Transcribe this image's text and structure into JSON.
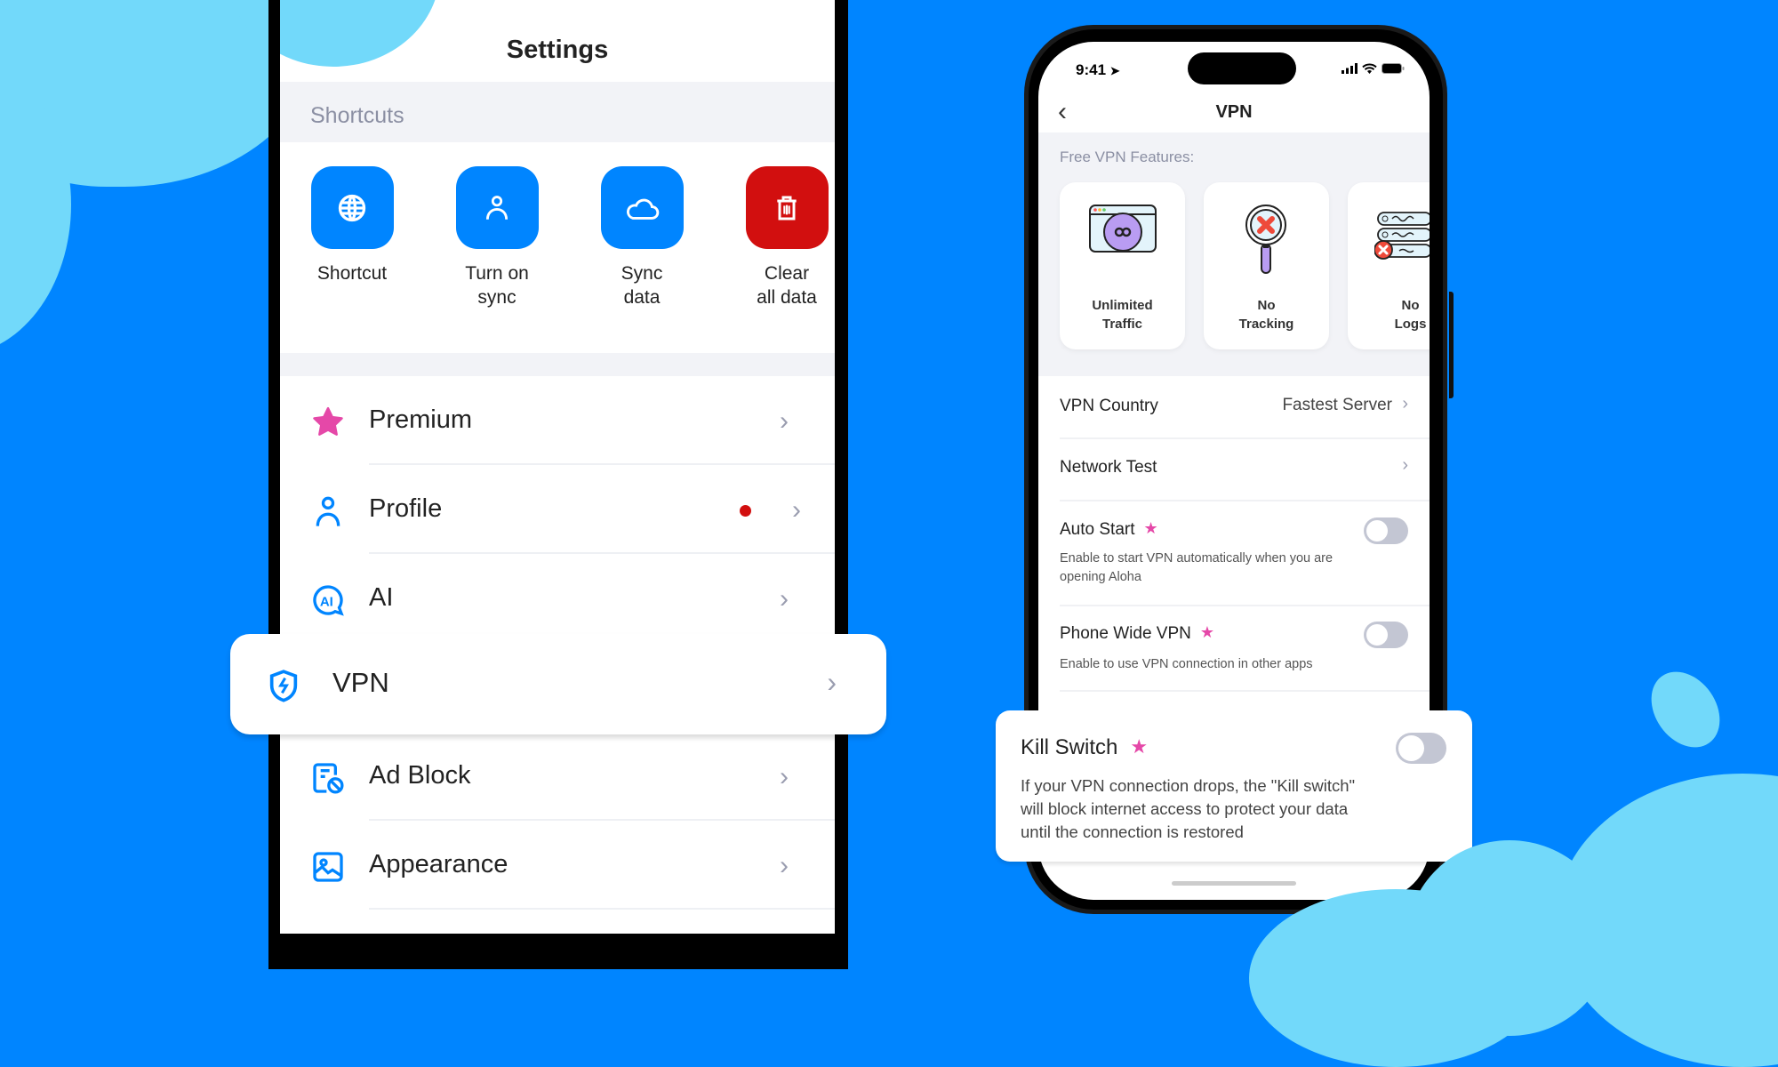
{
  "colors": {
    "background": "#0085FF",
    "blob": "#72D9FA",
    "accent_blue": "#0085FF",
    "danger_red": "#D20F0F",
    "premium_pink": "#E548A8",
    "toggle_off": "#C3C6D3"
  },
  "settings_screen": {
    "title": "Settings",
    "shortcuts_header": "Shortcuts",
    "shortcuts": [
      {
        "icon": "globe-icon",
        "label": "Shortcut"
      },
      {
        "icon": "person-icon",
        "label": "Turn on\nsync"
      },
      {
        "icon": "cloud-icon",
        "label": "Sync\ndata"
      },
      {
        "icon": "trash-icon",
        "label": "Clear\nall data"
      }
    ],
    "items": [
      {
        "icon": "star-icon",
        "label": "Premium",
        "chevron": "›"
      },
      {
        "icon": "person-icon",
        "label": "Profile",
        "chevron": "›",
        "badge": "red-dot"
      },
      {
        "icon": "ai-chat-icon",
        "label": "AI",
        "chevron": "›"
      },
      {
        "icon": "shield-bolt-icon",
        "label": "VPN",
        "chevron": "›",
        "highlighted": true
      },
      {
        "icon": "ad-block-icon",
        "label": "Ad Block",
        "chevron": "›"
      },
      {
        "icon": "image-icon",
        "label": "Appearance",
        "chevron": "›"
      }
    ]
  },
  "vpn_screen": {
    "status_bar": {
      "time": "9:41"
    },
    "nav": {
      "back": "‹",
      "title": "VPN"
    },
    "features_header": "Free VPN Features:",
    "features": [
      {
        "icon": "unlimited-traffic-icon",
        "line1": "Unlimited",
        "line2": "Traffic"
      },
      {
        "icon": "no-tracking-icon",
        "line1": "No",
        "line2": "Tracking"
      },
      {
        "icon": "no-logs-icon",
        "line1": "No",
        "line2": "Logs"
      }
    ],
    "rows": [
      {
        "label": "VPN Country",
        "value": "Fastest Server",
        "chevron": "›"
      },
      {
        "label": "Network Test",
        "chevron": "›"
      },
      {
        "label": "Auto Start",
        "premium": true,
        "description": "Enable to start VPN automatically when you are opening Aloha",
        "toggle_on": false
      },
      {
        "label": "Phone Wide VPN",
        "premium": true,
        "description": "Enable to use VPN connection in other apps",
        "toggle_on": false
      }
    ],
    "kill_switch": {
      "label": "Kill Switch",
      "premium": true,
      "description": "If your VPN connection drops, the \"Kill switch\" will block internet access to protect your data until the connection is restored",
      "toggle_on": false
    }
  }
}
